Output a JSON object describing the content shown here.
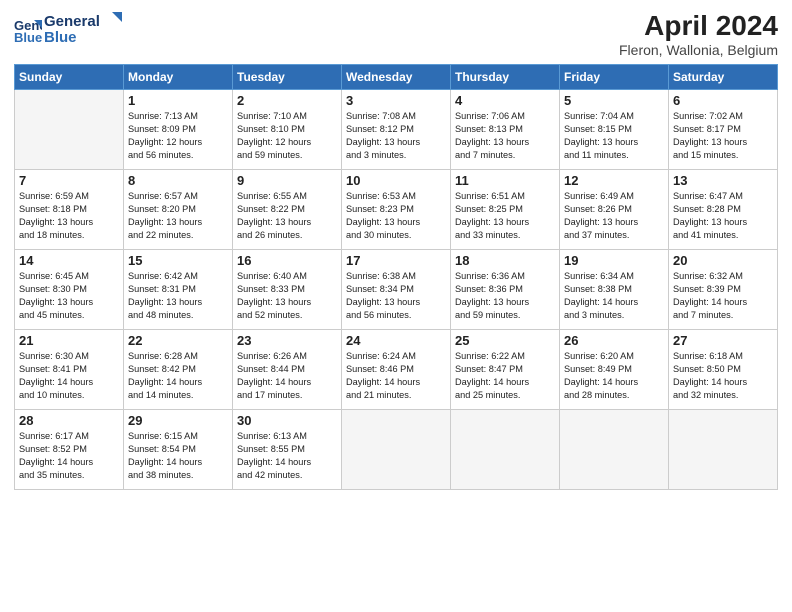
{
  "logo": {
    "line1": "General",
    "line2": "Blue"
  },
  "title": "April 2024",
  "subtitle": "Fleron, Wallonia, Belgium",
  "days_header": [
    "Sunday",
    "Monday",
    "Tuesday",
    "Wednesday",
    "Thursday",
    "Friday",
    "Saturday"
  ],
  "weeks": [
    [
      {
        "day": "",
        "text": ""
      },
      {
        "day": "1",
        "text": "Sunrise: 7:13 AM\nSunset: 8:09 PM\nDaylight: 12 hours\nand 56 minutes."
      },
      {
        "day": "2",
        "text": "Sunrise: 7:10 AM\nSunset: 8:10 PM\nDaylight: 12 hours\nand 59 minutes."
      },
      {
        "day": "3",
        "text": "Sunrise: 7:08 AM\nSunset: 8:12 PM\nDaylight: 13 hours\nand 3 minutes."
      },
      {
        "day": "4",
        "text": "Sunrise: 7:06 AM\nSunset: 8:13 PM\nDaylight: 13 hours\nand 7 minutes."
      },
      {
        "day": "5",
        "text": "Sunrise: 7:04 AM\nSunset: 8:15 PM\nDaylight: 13 hours\nand 11 minutes."
      },
      {
        "day": "6",
        "text": "Sunrise: 7:02 AM\nSunset: 8:17 PM\nDaylight: 13 hours\nand 15 minutes."
      }
    ],
    [
      {
        "day": "7",
        "text": "Sunrise: 6:59 AM\nSunset: 8:18 PM\nDaylight: 13 hours\nand 18 minutes."
      },
      {
        "day": "8",
        "text": "Sunrise: 6:57 AM\nSunset: 8:20 PM\nDaylight: 13 hours\nand 22 minutes."
      },
      {
        "day": "9",
        "text": "Sunrise: 6:55 AM\nSunset: 8:22 PM\nDaylight: 13 hours\nand 26 minutes."
      },
      {
        "day": "10",
        "text": "Sunrise: 6:53 AM\nSunset: 8:23 PM\nDaylight: 13 hours\nand 30 minutes."
      },
      {
        "day": "11",
        "text": "Sunrise: 6:51 AM\nSunset: 8:25 PM\nDaylight: 13 hours\nand 33 minutes."
      },
      {
        "day": "12",
        "text": "Sunrise: 6:49 AM\nSunset: 8:26 PM\nDaylight: 13 hours\nand 37 minutes."
      },
      {
        "day": "13",
        "text": "Sunrise: 6:47 AM\nSunset: 8:28 PM\nDaylight: 13 hours\nand 41 minutes."
      }
    ],
    [
      {
        "day": "14",
        "text": "Sunrise: 6:45 AM\nSunset: 8:30 PM\nDaylight: 13 hours\nand 45 minutes."
      },
      {
        "day": "15",
        "text": "Sunrise: 6:42 AM\nSunset: 8:31 PM\nDaylight: 13 hours\nand 48 minutes."
      },
      {
        "day": "16",
        "text": "Sunrise: 6:40 AM\nSunset: 8:33 PM\nDaylight: 13 hours\nand 52 minutes."
      },
      {
        "day": "17",
        "text": "Sunrise: 6:38 AM\nSunset: 8:34 PM\nDaylight: 13 hours\nand 56 minutes."
      },
      {
        "day": "18",
        "text": "Sunrise: 6:36 AM\nSunset: 8:36 PM\nDaylight: 13 hours\nand 59 minutes."
      },
      {
        "day": "19",
        "text": "Sunrise: 6:34 AM\nSunset: 8:38 PM\nDaylight: 14 hours\nand 3 minutes."
      },
      {
        "day": "20",
        "text": "Sunrise: 6:32 AM\nSunset: 8:39 PM\nDaylight: 14 hours\nand 7 minutes."
      }
    ],
    [
      {
        "day": "21",
        "text": "Sunrise: 6:30 AM\nSunset: 8:41 PM\nDaylight: 14 hours\nand 10 minutes."
      },
      {
        "day": "22",
        "text": "Sunrise: 6:28 AM\nSunset: 8:42 PM\nDaylight: 14 hours\nand 14 minutes."
      },
      {
        "day": "23",
        "text": "Sunrise: 6:26 AM\nSunset: 8:44 PM\nDaylight: 14 hours\nand 17 minutes."
      },
      {
        "day": "24",
        "text": "Sunrise: 6:24 AM\nSunset: 8:46 PM\nDaylight: 14 hours\nand 21 minutes."
      },
      {
        "day": "25",
        "text": "Sunrise: 6:22 AM\nSunset: 8:47 PM\nDaylight: 14 hours\nand 25 minutes."
      },
      {
        "day": "26",
        "text": "Sunrise: 6:20 AM\nSunset: 8:49 PM\nDaylight: 14 hours\nand 28 minutes."
      },
      {
        "day": "27",
        "text": "Sunrise: 6:18 AM\nSunset: 8:50 PM\nDaylight: 14 hours\nand 32 minutes."
      }
    ],
    [
      {
        "day": "28",
        "text": "Sunrise: 6:17 AM\nSunset: 8:52 PM\nDaylight: 14 hours\nand 35 minutes."
      },
      {
        "day": "29",
        "text": "Sunrise: 6:15 AM\nSunset: 8:54 PM\nDaylight: 14 hours\nand 38 minutes."
      },
      {
        "day": "30",
        "text": "Sunrise: 6:13 AM\nSunset: 8:55 PM\nDaylight: 14 hours\nand 42 minutes."
      },
      {
        "day": "",
        "text": ""
      },
      {
        "day": "",
        "text": ""
      },
      {
        "day": "",
        "text": ""
      },
      {
        "day": "",
        "text": ""
      }
    ]
  ]
}
